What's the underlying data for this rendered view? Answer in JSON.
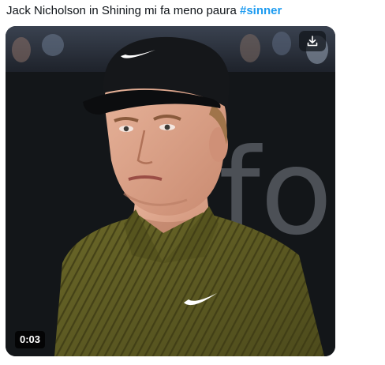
{
  "post": {
    "text": "Jack Nicholson in Shining mi fa meno paura ",
    "hashtag": "#sinner"
  },
  "media": {
    "type": "video",
    "duration": "0:03",
    "download_icon": "download-icon",
    "background_letters": "fo"
  },
  "colors": {
    "hashtag": "#1d9bf0",
    "text": "#0f1419",
    "shirt": "#5c5a22",
    "cap": "#15171a",
    "badge_bg": "#000000"
  }
}
